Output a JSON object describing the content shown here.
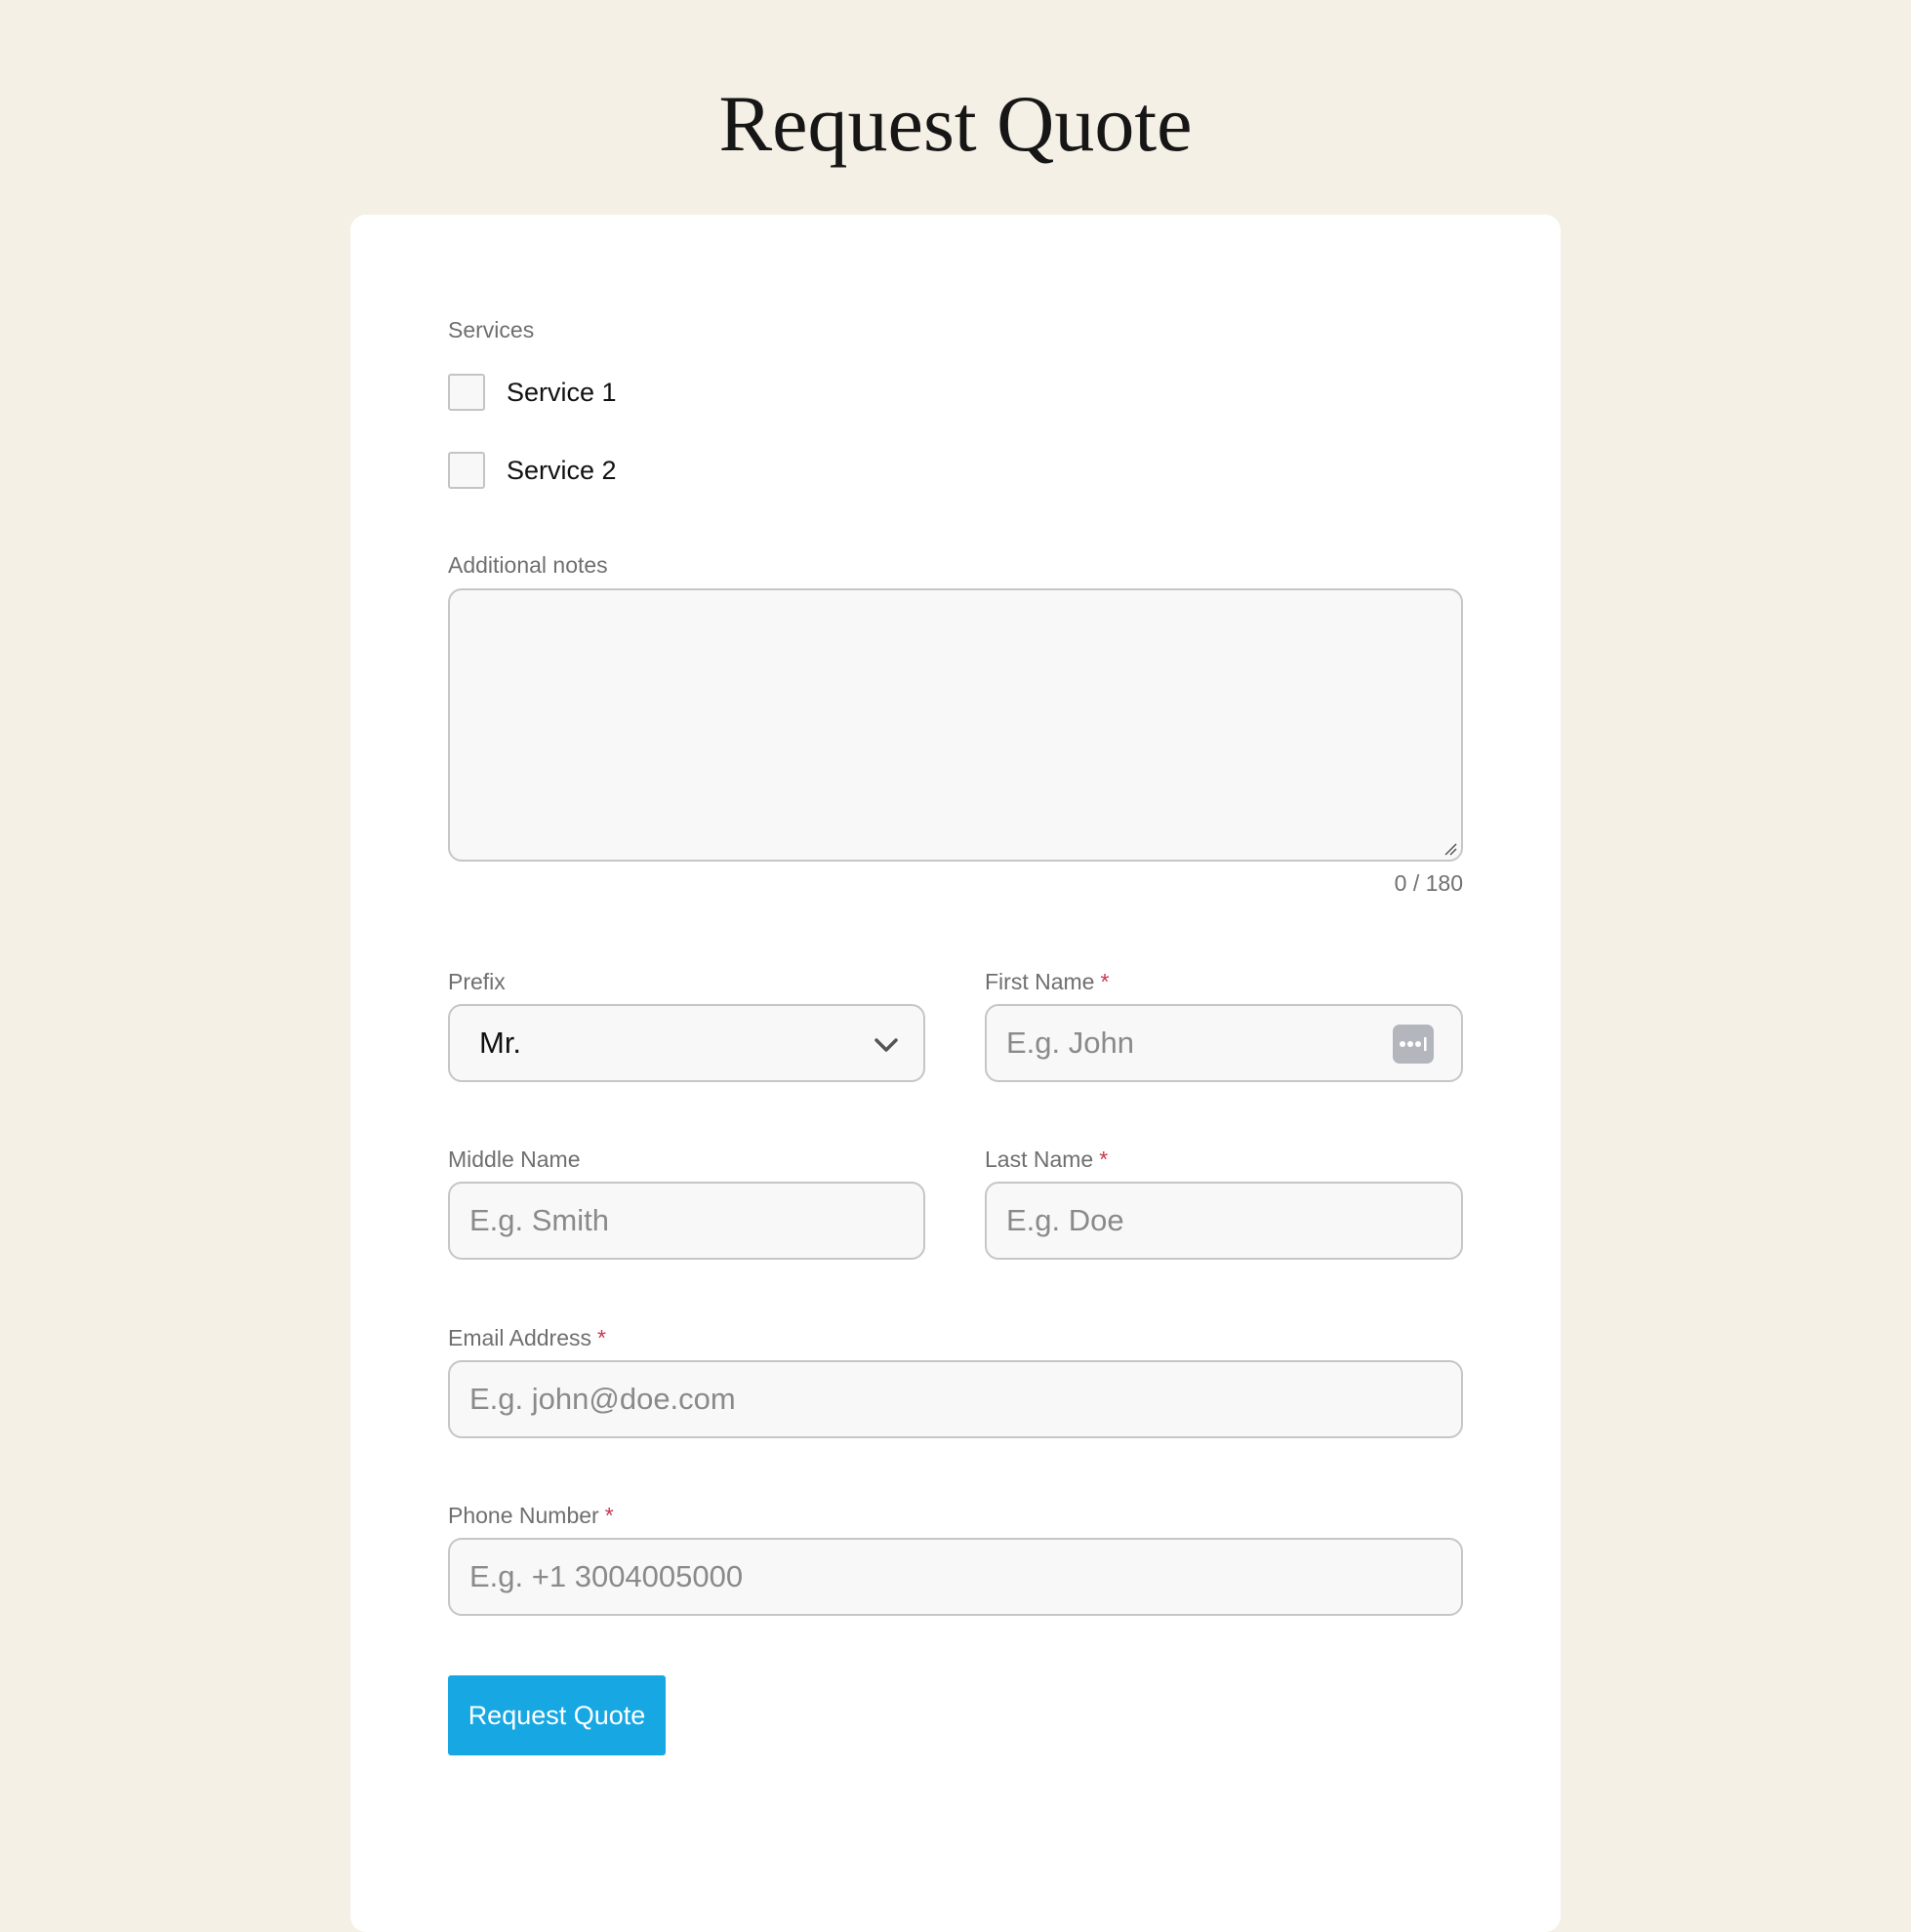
{
  "page": {
    "title": "Request Quote"
  },
  "form": {
    "services": {
      "label": "Services",
      "options": [
        {
          "label": "Service 1",
          "checked": false
        },
        {
          "label": "Service 2",
          "checked": false
        }
      ]
    },
    "notes": {
      "label": "Additional notes",
      "value": "",
      "counter": "0 / 180"
    },
    "prefix": {
      "label": "Prefix",
      "value": "Mr.",
      "icon": "chevron-down-icon"
    },
    "first_name": {
      "label": "First Name",
      "required_mark": "*",
      "placeholder": "E.g. John",
      "icon": "password-manager-icon"
    },
    "middle_name": {
      "label": "Middle Name",
      "placeholder": "E.g. Smith"
    },
    "last_name": {
      "label": "Last Name",
      "required_mark": "*",
      "placeholder": "E.g. Doe"
    },
    "email": {
      "label": "Email Address",
      "required_mark": "*",
      "placeholder": "E.g. john@doe.com"
    },
    "phone": {
      "label": "Phone Number",
      "required_mark": "*",
      "placeholder": "E.g. +1 3004005000"
    },
    "submit_label": "Request Quote"
  },
  "colors": {
    "background": "#f5f0e5",
    "card": "#ffffff",
    "accent": "#17a8e3",
    "required": "#c8374f"
  }
}
